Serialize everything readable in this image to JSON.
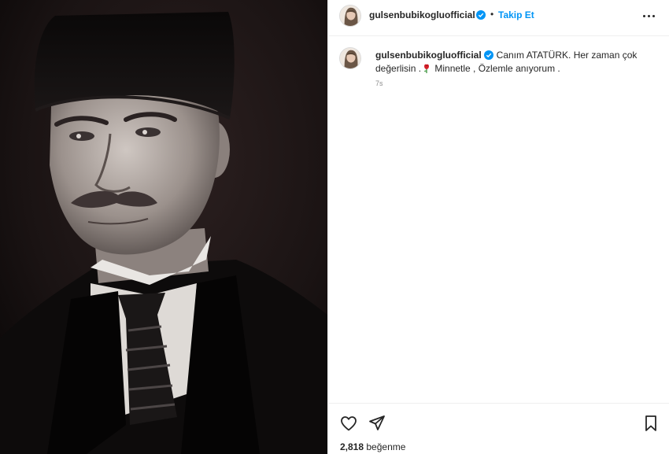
{
  "header": {
    "username": "gulsenbubikogluofficial",
    "separator": "•",
    "follow_label": "Takip Et"
  },
  "caption": {
    "username": "gulsenbubikogluofficial",
    "text_part1": "Canım ATATÜRK. Her zaman çok değerlisin .",
    "text_part2": " Minnetle , Özlemle anıyorum .",
    "timestamp": "7s"
  },
  "footer": {
    "likes_count": "2,818",
    "likes_label": "beğenme"
  },
  "icons": {
    "verified": "verified-badge-icon",
    "more": "more-options-icon",
    "like": "heart-icon",
    "share": "paper-plane-icon",
    "save": "bookmark-icon",
    "emoji": "rose-emoji-icon"
  },
  "colors": {
    "accent": "#0095f6",
    "text": "#262626",
    "muted": "#8e8e8e",
    "border": "#efefef"
  }
}
